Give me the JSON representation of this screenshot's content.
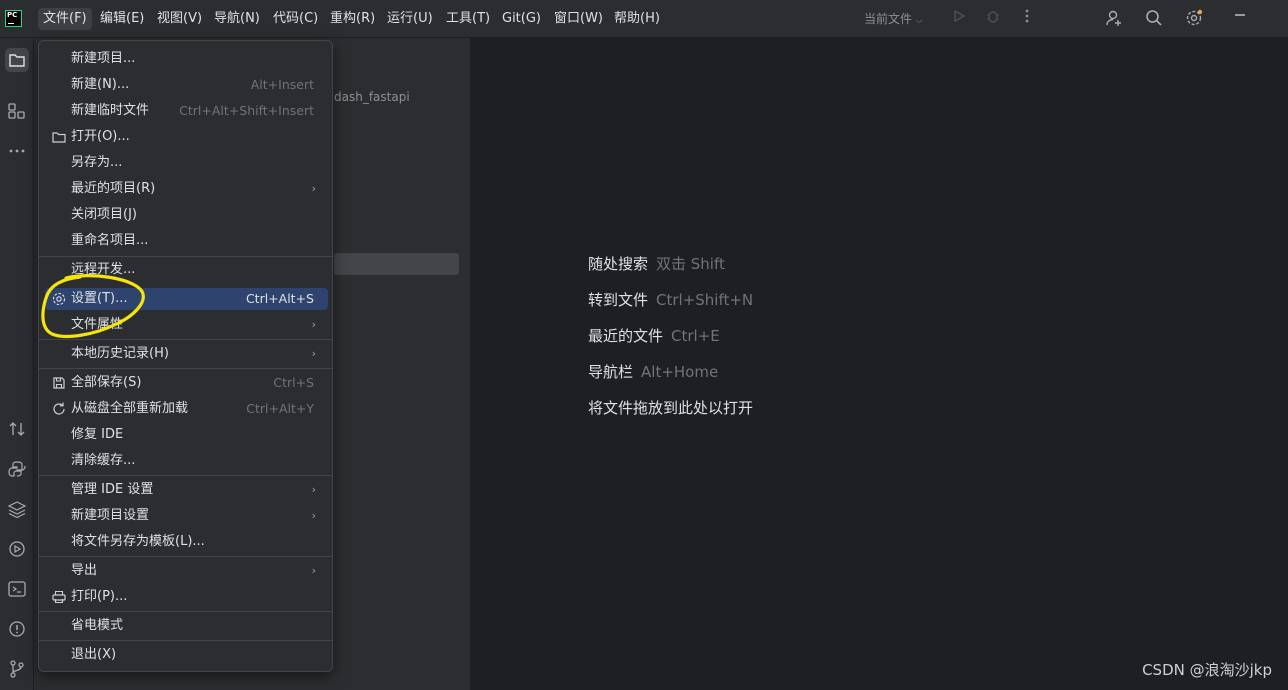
{
  "menubar": {
    "items": [
      {
        "label": "文件(F)",
        "cls": "mi-file"
      },
      {
        "label": "编辑(E)",
        "cls": "mi-edit"
      },
      {
        "label": "视图(V)",
        "cls": "mi-view"
      },
      {
        "label": "导航(N)",
        "cls": "mi-nav"
      },
      {
        "label": "代码(C)",
        "cls": "mi-code"
      },
      {
        "label": "重构(R)",
        "cls": "mi-refactor"
      },
      {
        "label": "运行(U)",
        "cls": "mi-run"
      },
      {
        "label": "工具(T)",
        "cls": "mi-tools"
      },
      {
        "label": "Git(G)",
        "cls": "mi-git"
      },
      {
        "label": "窗口(W)",
        "cls": "mi-window"
      },
      {
        "label": "帮助(H)",
        "cls": "mi-help"
      }
    ],
    "run_config": "当前文件",
    "logo_text": "PC"
  },
  "project": {
    "node_label": "dash_fastapi"
  },
  "file_menu": {
    "items": [
      {
        "label": "新建项目...",
        "shortcut": "",
        "submenu": false,
        "icon": ""
      },
      {
        "label": "新建(N)...",
        "shortcut": "Alt+Insert",
        "submenu": false,
        "icon": ""
      },
      {
        "label": "新建临时文件",
        "shortcut": "Ctrl+Alt+Shift+Insert",
        "submenu": false,
        "icon": ""
      },
      {
        "label": "打开(O)...",
        "shortcut": "",
        "submenu": false,
        "icon": "folder-icon"
      },
      {
        "label": "另存为...",
        "shortcut": "",
        "submenu": false,
        "icon": ""
      },
      {
        "label": "最近的项目(R)",
        "shortcut": "",
        "submenu": true,
        "icon": ""
      },
      {
        "label": "关闭项目(J)",
        "shortcut": "",
        "submenu": false,
        "icon": ""
      },
      {
        "label": "重命名项目...",
        "shortcut": "",
        "submenu": false,
        "icon": ""
      },
      {
        "label": "远程开发...",
        "shortcut": "",
        "submenu": false,
        "icon": ""
      },
      {
        "label": "设置(T)...",
        "shortcut": "Ctrl+Alt+S",
        "submenu": false,
        "icon": "gear-icon",
        "highlight": true
      },
      {
        "label": "文件属性",
        "shortcut": "",
        "submenu": true,
        "icon": ""
      },
      {
        "label": "本地历史记录(H)",
        "shortcut": "",
        "submenu": true,
        "icon": ""
      },
      {
        "label": "全部保存(S)",
        "shortcut": "Ctrl+S",
        "submenu": false,
        "icon": "save-icon"
      },
      {
        "label": "从磁盘全部重新加载",
        "shortcut": "Ctrl+Alt+Y",
        "submenu": false,
        "icon": "reload-icon"
      },
      {
        "label": "修复 IDE",
        "shortcut": "",
        "submenu": false,
        "icon": ""
      },
      {
        "label": "清除缓存...",
        "shortcut": "",
        "submenu": false,
        "icon": ""
      },
      {
        "label": "管理 IDE 设置",
        "shortcut": "",
        "submenu": true,
        "icon": ""
      },
      {
        "label": "新建项目设置",
        "shortcut": "",
        "submenu": true,
        "icon": ""
      },
      {
        "label": "将文件另存为模板(L)...",
        "shortcut": "",
        "submenu": false,
        "icon": ""
      },
      {
        "label": "导出",
        "shortcut": "",
        "submenu": true,
        "icon": ""
      },
      {
        "label": "打印(P)...",
        "shortcut": "",
        "submenu": false,
        "icon": "print-icon"
      },
      {
        "label": "省电模式",
        "shortcut": "",
        "submenu": false,
        "icon": ""
      },
      {
        "label": "退出(X)",
        "shortcut": "",
        "submenu": false,
        "icon": ""
      }
    ]
  },
  "editor_hints": [
    {
      "label": "随处搜索",
      "shortcut": "双击 Shift"
    },
    {
      "label": "转到文件",
      "shortcut": "Ctrl+Shift+N"
    },
    {
      "label": "最近的文件",
      "shortcut": "Ctrl+E"
    },
    {
      "label": "导航栏",
      "shortcut": "Alt+Home"
    },
    {
      "label": "将文件拖放到此处以打开",
      "shortcut": ""
    }
  ],
  "watermark": "CSDN @浪淘沙jkp",
  "colors": {
    "highlight": "#2e436e",
    "annotation": "#f5e50a",
    "menu_bg": "#2b2d30",
    "editor_bg": "#1e1f22"
  }
}
